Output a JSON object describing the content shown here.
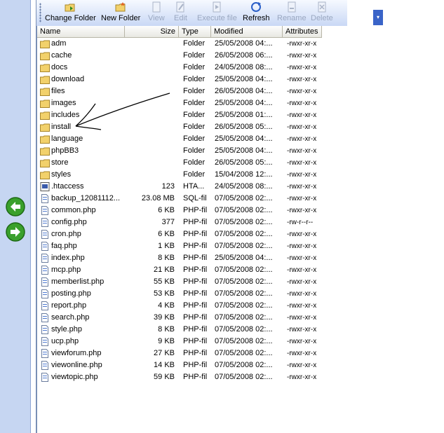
{
  "toolbar": {
    "buttons": [
      {
        "label": "Change Folder",
        "icon": "change-folder-icon",
        "enabled": true
      },
      {
        "label": "New Folder",
        "icon": "new-folder-icon",
        "enabled": true
      },
      {
        "label": "View",
        "icon": "view-icon",
        "enabled": false
      },
      {
        "label": "Edit",
        "icon": "edit-icon",
        "enabled": false
      },
      {
        "label": "Execute file",
        "icon": "execute-icon",
        "enabled": false
      },
      {
        "label": "Refresh",
        "icon": "refresh-icon",
        "enabled": true
      },
      {
        "label": "Rename",
        "icon": "rename-icon",
        "enabled": false
      },
      {
        "label": "Delete",
        "icon": "delete-icon",
        "enabled": false
      }
    ]
  },
  "columns": {
    "name": "Name",
    "size": "Size",
    "type": "Type",
    "modified": "Modified",
    "attributes": "Attributes"
  },
  "files": [
    {
      "name": "adm",
      "size": "",
      "type": "Folder",
      "modified": "25/05/2008 04:...",
      "attributes": "-rwxr-xr-x",
      "icon": "folder-icon"
    },
    {
      "name": "cache",
      "size": "",
      "type": "Folder",
      "modified": "26/05/2008 06:...",
      "attributes": "-rwxr-xr-x",
      "icon": "folder-icon"
    },
    {
      "name": "docs",
      "size": "",
      "type": "Folder",
      "modified": "24/05/2008 08:...",
      "attributes": "-rwxr-xr-x",
      "icon": "folder-icon"
    },
    {
      "name": "download",
      "size": "",
      "type": "Folder",
      "modified": "25/05/2008 04:...",
      "attributes": "-rwxr-xr-x",
      "icon": "folder-icon"
    },
    {
      "name": "files",
      "size": "",
      "type": "Folder",
      "modified": "26/05/2008 04:...",
      "attributes": "-rwxr-xr-x",
      "icon": "folder-icon"
    },
    {
      "name": "images",
      "size": "",
      "type": "Folder",
      "modified": "25/05/2008 04:...",
      "attributes": "-rwxr-xr-x",
      "icon": "folder-icon"
    },
    {
      "name": "includes",
      "size": "",
      "type": "Folder",
      "modified": "25/05/2008 01:...",
      "attributes": "-rwxr-xr-x",
      "icon": "folder-icon"
    },
    {
      "name": "install",
      "size": "",
      "type": "Folder",
      "modified": "26/05/2008 05:...",
      "attributes": "-rwxr-xr-x",
      "icon": "folder-icon"
    },
    {
      "name": "language",
      "size": "",
      "type": "Folder",
      "modified": "25/05/2008 04:...",
      "attributes": "-rwxr-xr-x",
      "icon": "folder-icon"
    },
    {
      "name": "phpBB3",
      "size": "",
      "type": "Folder",
      "modified": "25/05/2008 04:...",
      "attributes": "-rwxr-xr-x",
      "icon": "folder-icon"
    },
    {
      "name": "store",
      "size": "",
      "type": "Folder",
      "modified": "26/05/2008 05:...",
      "attributes": "-rwxr-xr-x",
      "icon": "folder-icon"
    },
    {
      "name": "styles",
      "size": "",
      "type": "Folder",
      "modified": "15/04/2008 12:...",
      "attributes": "-rwxr-xr-x",
      "icon": "folder-icon"
    },
    {
      "name": ".htaccess",
      "size": "123",
      "type": "HTA...",
      "modified": "24/05/2008 08:...",
      "attributes": "-rwxr-xr-x",
      "icon": "htaccess-file-icon"
    },
    {
      "name": "backup_12081112...",
      "size": "23.08 MB",
      "type": "SQL-fil",
      "modified": "07/05/2008 02:...",
      "attributes": "-rwxr-xr-x",
      "icon": "file-icon"
    },
    {
      "name": "common.php",
      "size": "6 KB",
      "type": "PHP-fil",
      "modified": "07/05/2008 02:...",
      "attributes": "-rwxr-xr-x",
      "icon": "file-icon"
    },
    {
      "name": "config.php",
      "size": "377",
      "type": "PHP-fil",
      "modified": "07/05/2008 02:...",
      "attributes": "-rw-r--r--",
      "icon": "file-icon"
    },
    {
      "name": "cron.php",
      "size": "6 KB",
      "type": "PHP-fil",
      "modified": "07/05/2008 02:...",
      "attributes": "-rwxr-xr-x",
      "icon": "file-icon"
    },
    {
      "name": "faq.php",
      "size": "1 KB",
      "type": "PHP-fil",
      "modified": "07/05/2008 02:...",
      "attributes": "-rwxr-xr-x",
      "icon": "file-icon"
    },
    {
      "name": "index.php",
      "size": "8 KB",
      "type": "PHP-fil",
      "modified": "25/05/2008 04:...",
      "attributes": "-rwxr-xr-x",
      "icon": "file-icon"
    },
    {
      "name": "mcp.php",
      "size": "21 KB",
      "type": "PHP-fil",
      "modified": "07/05/2008 02:...",
      "attributes": "-rwxr-xr-x",
      "icon": "file-icon"
    },
    {
      "name": "memberlist.php",
      "size": "55 KB",
      "type": "PHP-fil",
      "modified": "07/05/2008 02:...",
      "attributes": "-rwxr-xr-x",
      "icon": "file-icon"
    },
    {
      "name": "posting.php",
      "size": "53 KB",
      "type": "PHP-fil",
      "modified": "07/05/2008 02:...",
      "attributes": "-rwxr-xr-x",
      "icon": "file-icon"
    },
    {
      "name": "report.php",
      "size": "4 KB",
      "type": "PHP-fil",
      "modified": "07/05/2008 02:...",
      "attributes": "-rwxr-xr-x",
      "icon": "file-icon"
    },
    {
      "name": "search.php",
      "size": "39 KB",
      "type": "PHP-fil",
      "modified": "07/05/2008 02:...",
      "attributes": "-rwxr-xr-x",
      "icon": "file-icon"
    },
    {
      "name": "style.php",
      "size": "8 KB",
      "type": "PHP-fil",
      "modified": "07/05/2008 02:...",
      "attributes": "-rwxr-xr-x",
      "icon": "file-icon"
    },
    {
      "name": "ucp.php",
      "size": "9 KB",
      "type": "PHP-fil",
      "modified": "07/05/2008 02:...",
      "attributes": "-rwxr-xr-x",
      "icon": "file-icon"
    },
    {
      "name": "viewforum.php",
      "size": "27 KB",
      "type": "PHP-fil",
      "modified": "07/05/2008 02:...",
      "attributes": "-rwxr-xr-x",
      "icon": "file-icon"
    },
    {
      "name": "viewonline.php",
      "size": "14 KB",
      "type": "PHP-fil",
      "modified": "07/05/2008 02:...",
      "attributes": "-rwxr-xr-x",
      "icon": "file-icon"
    },
    {
      "name": "viewtopic.php",
      "size": "59 KB",
      "type": "PHP-fil",
      "modified": "07/05/2008 02:...",
      "attributes": "-rwxr-xr-x",
      "icon": "file-icon"
    }
  ],
  "nav": {
    "back_icon": "arrow-left-icon",
    "forward_icon": "arrow-right-icon"
  },
  "colors": {
    "panel": "#c6d6f2",
    "accent": "#3a9a2a",
    "folder": "#f2d16b"
  }
}
